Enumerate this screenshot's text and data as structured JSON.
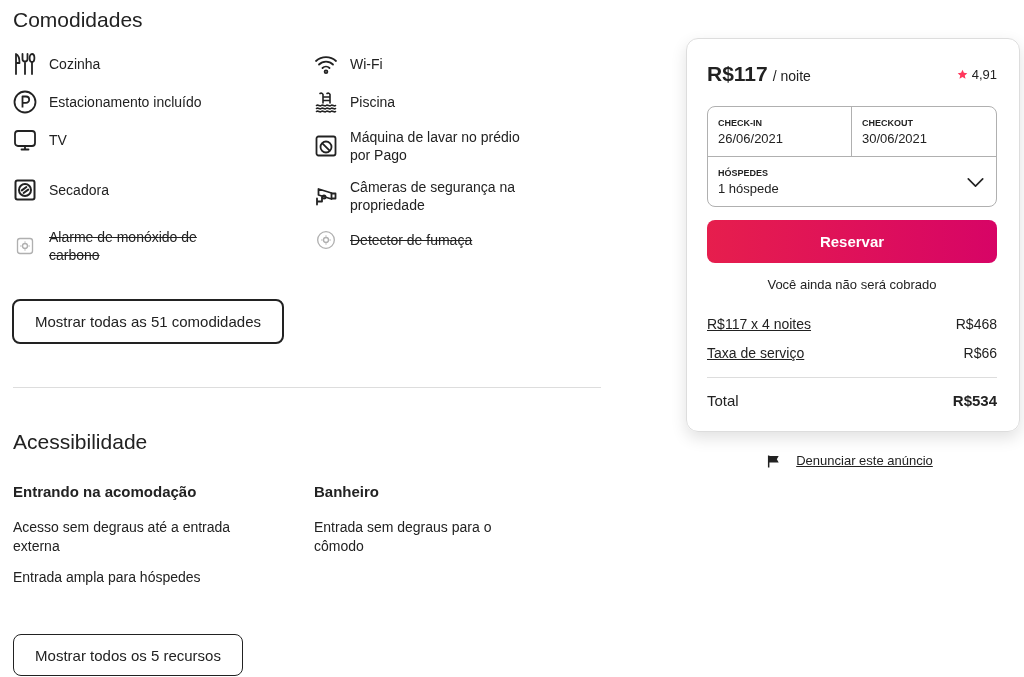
{
  "amenities": {
    "title": "Comodidades",
    "items": [
      {
        "label": "Cozinha",
        "available": true
      },
      {
        "label": "Wi-Fi",
        "available": true
      },
      {
        "label": "Estacionamento incluído",
        "available": true
      },
      {
        "label": "Piscina",
        "available": true
      },
      {
        "label": "TV",
        "available": true
      },
      {
        "label": "Máquina de lavar no prédio por Pago",
        "available": true
      },
      {
        "label": "Secadora",
        "available": true
      },
      {
        "label": "Câmeras de segurança na propriedade",
        "available": true
      },
      {
        "label": "Alarme de monóxido de carbono",
        "available": false
      },
      {
        "label": "Detector de fumaça",
        "available": false
      }
    ],
    "show_all_button": "Mostrar todas as 51 comodidades"
  },
  "accessibility": {
    "title": "Acessibilidade",
    "groups": [
      {
        "title": "Entrando na acomodação",
        "items": [
          "Acesso sem degraus até a entrada externa",
          "Entrada ampla para hóspedes"
        ]
      },
      {
        "title": "Banheiro",
        "items": [
          "Entrada sem degraus para o cômodo"
        ]
      }
    ],
    "show_all_button": "Mostrar todos os 5 recursos"
  },
  "booking": {
    "price": "R$117",
    "unit": "/ noite",
    "rating": "4,91",
    "check_in": {
      "label": "CHECK-IN",
      "value": "26/06/2021"
    },
    "checkout": {
      "label": "CHECKOUT",
      "value": "30/06/2021"
    },
    "guests": {
      "label": "HÓSPEDES",
      "value": "1 hóspede"
    },
    "reserve_button": "Reservar",
    "note": "Você ainda não será cobrado",
    "line_items": [
      {
        "label": "R$117 x 4 noites",
        "amount": "R$468"
      },
      {
        "label": "Taxa de serviço",
        "amount": "R$66"
      }
    ],
    "total": {
      "label": "Total",
      "amount": "R$534"
    }
  },
  "report_link": "Denunciar este anúncio"
}
